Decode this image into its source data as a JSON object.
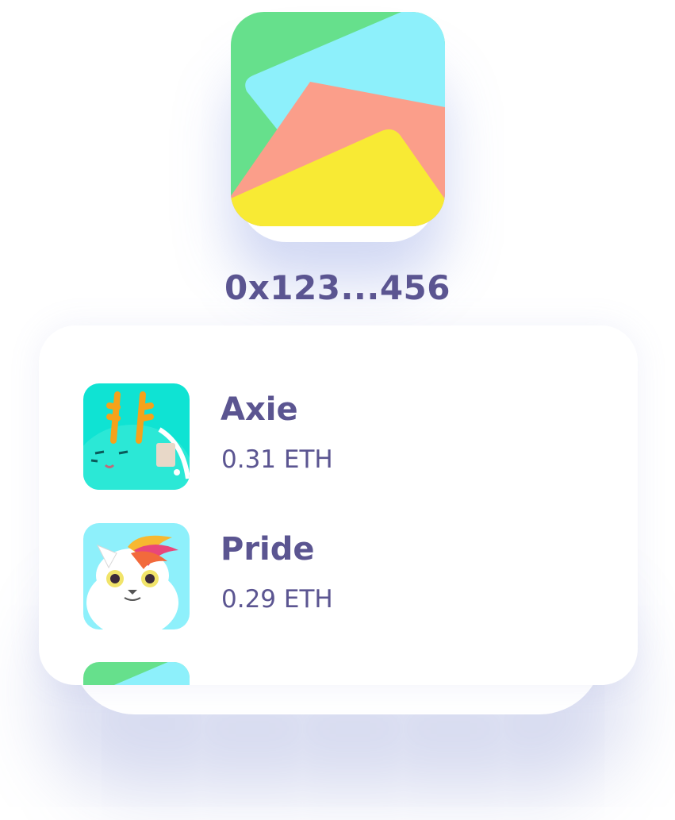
{
  "wallet": {
    "logo_icon": "wallet-multicolor-logo-icon",
    "address": "0x123...456"
  },
  "colors": {
    "text": "#5b5591",
    "green": "#66e08c",
    "cyan": "#8df0fb",
    "salmon": "#fb9e8a",
    "yellow": "#f8ea34"
  },
  "assets": [
    {
      "name": "Axie",
      "price": "0.31 ETH",
      "thumb_icon": "axie-cyan-creature-icon"
    },
    {
      "name": "Pride",
      "price": "0.29 ETH",
      "thumb_icon": "pride-white-cat-icon"
    },
    {
      "thumb_icon": "wallet-multicolor-logo-icon"
    }
  ]
}
